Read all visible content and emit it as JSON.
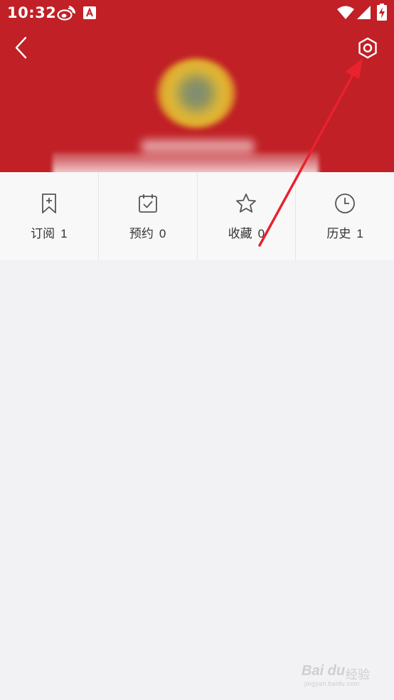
{
  "status_bar": {
    "time": "10:32",
    "icons": [
      "weibo-icon",
      "app-notification-icon",
      "wifi-icon",
      "signal-icon",
      "battery-icon"
    ]
  },
  "header": {
    "background_color": "#c02026",
    "back_icon": "chevron-left-icon",
    "settings_icon": "gear-icon"
  },
  "tabs": [
    {
      "icon": "bookmark-add-icon",
      "label": "订阅",
      "count": "1"
    },
    {
      "icon": "calendar-check-icon",
      "label": "预约",
      "count": "0"
    },
    {
      "icon": "star-icon",
      "label": "收藏",
      "count": "0"
    },
    {
      "icon": "clock-icon",
      "label": "历史",
      "count": "1"
    }
  ],
  "watermark": {
    "brand": "Bai du",
    "product": "经验",
    "url": "jingyan.baidu.com"
  },
  "annotation_color": "#e8222e"
}
